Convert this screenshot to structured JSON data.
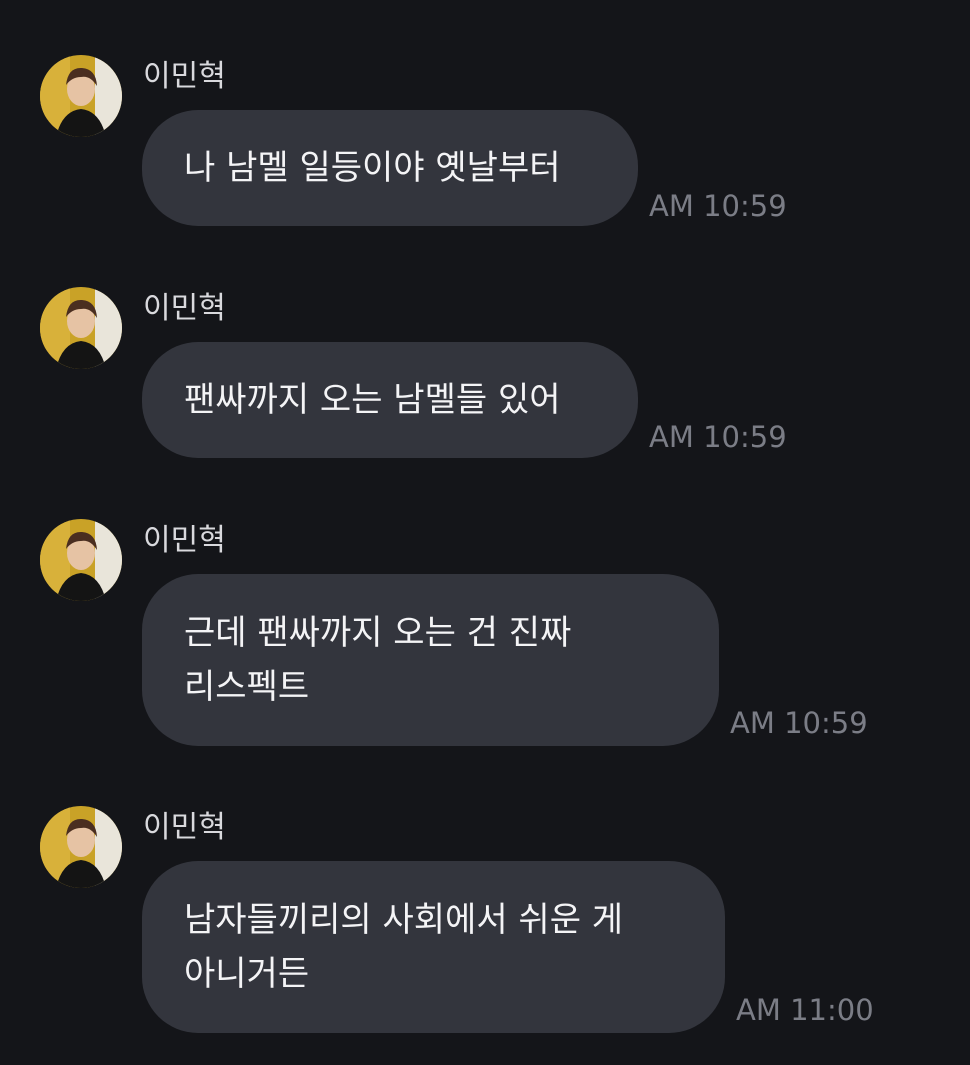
{
  "chat": {
    "messages": [
      {
        "sender": "이민혁",
        "lines": [
          "나 남멜 일등이야 옛날부터"
        ],
        "time": "AM 10:59"
      },
      {
        "sender": "이민혁",
        "lines": [
          "팬싸까지 오는 남멜들 있어"
        ],
        "time": "AM 10:59"
      },
      {
        "sender": "이민혁",
        "lines": [
          "근데 팬싸까지 오는 건 진짜",
          "리스펙트"
        ],
        "time": "AM 10:59"
      },
      {
        "sender": "이민혁",
        "lines": [
          "남자들끼리의 사회에서 쉬운 게",
          "아니거든"
        ],
        "time": "AM 11:00"
      }
    ]
  },
  "colors": {
    "background": "#141519",
    "bubble": "#33353d",
    "timestamp": "#7b7d86",
    "sender": "#d9d9dd"
  },
  "icons": {
    "avatar": "profile-photo-avatar"
  }
}
